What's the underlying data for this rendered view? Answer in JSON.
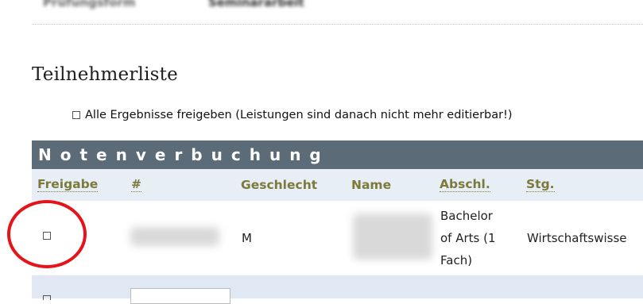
{
  "top_row": {
    "label": "Prüfungsform",
    "value": "Seminararbeit"
  },
  "section_title": "Teilnehmerliste",
  "release_all": {
    "label": "Alle Ergebnisse freigeben (Leistungen sind danach nicht mehr editierbar!)",
    "checked": false
  },
  "grid_title": "Notenverbuchung",
  "columns": [
    "Freigabe",
    "#",
    "Geschlecht",
    "Name",
    "Abschl.",
    "Stg."
  ],
  "rows": [
    {
      "freigabe_checked": false,
      "number": "",
      "geschlecht": "M",
      "name": "",
      "abschluss": [
        "Bachelor",
        "of Arts (1",
        "Fach)"
      ],
      "studiengang": "Wirtschaftswisse"
    }
  ],
  "colors": {
    "grid_header_bg": "#5b6b78",
    "col_header_bg": "#e7eef6",
    "row_alt_bg": "#dfe8f3",
    "header_link": "#7b7a3b",
    "annotation": "#e5141b"
  }
}
